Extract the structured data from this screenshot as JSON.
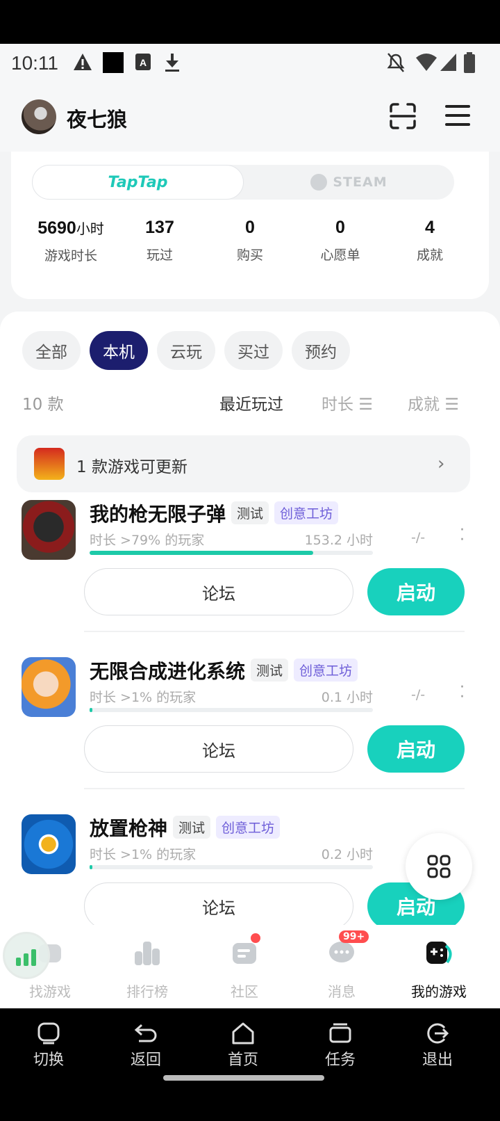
{
  "status_bar": {
    "time": "10:11"
  },
  "header": {
    "username": "夜七狼"
  },
  "platforms": {
    "taptap": "TapTap",
    "steam": "STEAM"
  },
  "stats": [
    {
      "value": "5690",
      "unit": "小时",
      "label": "游戏时长"
    },
    {
      "value": "137",
      "unit": "",
      "label": "玩过"
    },
    {
      "value": "0",
      "unit": "",
      "label": "购买"
    },
    {
      "value": "0",
      "unit": "",
      "label": "心愿单"
    },
    {
      "value": "4",
      "unit": "",
      "label": "成就"
    }
  ],
  "filters": [
    "全部",
    "本机",
    "云玩",
    "买过",
    "预约"
  ],
  "active_filter": "本机",
  "list_count": "10 款",
  "sort": {
    "recent": "最近玩过",
    "duration": "时长 ☰",
    "achievement": "成就 ☰"
  },
  "update_notice": "1 款游戏可更新",
  "games": [
    {
      "title": "我的枪无限子弹",
      "tag_test": "测试",
      "tag_creative": "创意工坊",
      "sub": "时长 >79% 的玩家",
      "hours": "153.2 小时",
      "progress": 0.79,
      "dash": "-/-",
      "forum": "论坛",
      "launch": "启动"
    },
    {
      "title": "无限合成进化系统",
      "tag_test": "测试",
      "tag_creative": "创意工坊",
      "sub": "时长 >1% 的玩家",
      "hours": "0.1 小时",
      "progress": 0.01,
      "dash": "-/-",
      "forum": "论坛",
      "launch": "启动"
    },
    {
      "title": "放置枪神",
      "tag_test": "测试",
      "tag_creative": "创意工坊",
      "sub": "时长 >1% 的玩家",
      "hours": "0.2 小时",
      "progress": 0.01,
      "dash": "",
      "forum": "论坛",
      "launch": "启动"
    }
  ],
  "bottom_nav": [
    {
      "label": "找游戏",
      "icon": "find-games-icon"
    },
    {
      "label": "排行榜",
      "icon": "leaderboard-icon"
    },
    {
      "label": "社区",
      "icon": "community-icon"
    },
    {
      "label": "消息",
      "icon": "messages-icon",
      "badge": "99+"
    },
    {
      "label": "我的游戏",
      "icon": "my-games-icon"
    }
  ],
  "system_nav": [
    {
      "label": "切换",
      "icon": "switch-icon"
    },
    {
      "label": "返回",
      "icon": "back-icon"
    },
    {
      "label": "首页",
      "icon": "home-icon"
    },
    {
      "label": "任务",
      "icon": "tasks-icon"
    },
    {
      "label": "退出",
      "icon": "exit-icon"
    }
  ],
  "colors": {
    "accent": "#18d1bd",
    "active_chip": "#1c1e6e",
    "creative_tag": "#6d5dd8",
    "badge": "#ff4d4f"
  }
}
